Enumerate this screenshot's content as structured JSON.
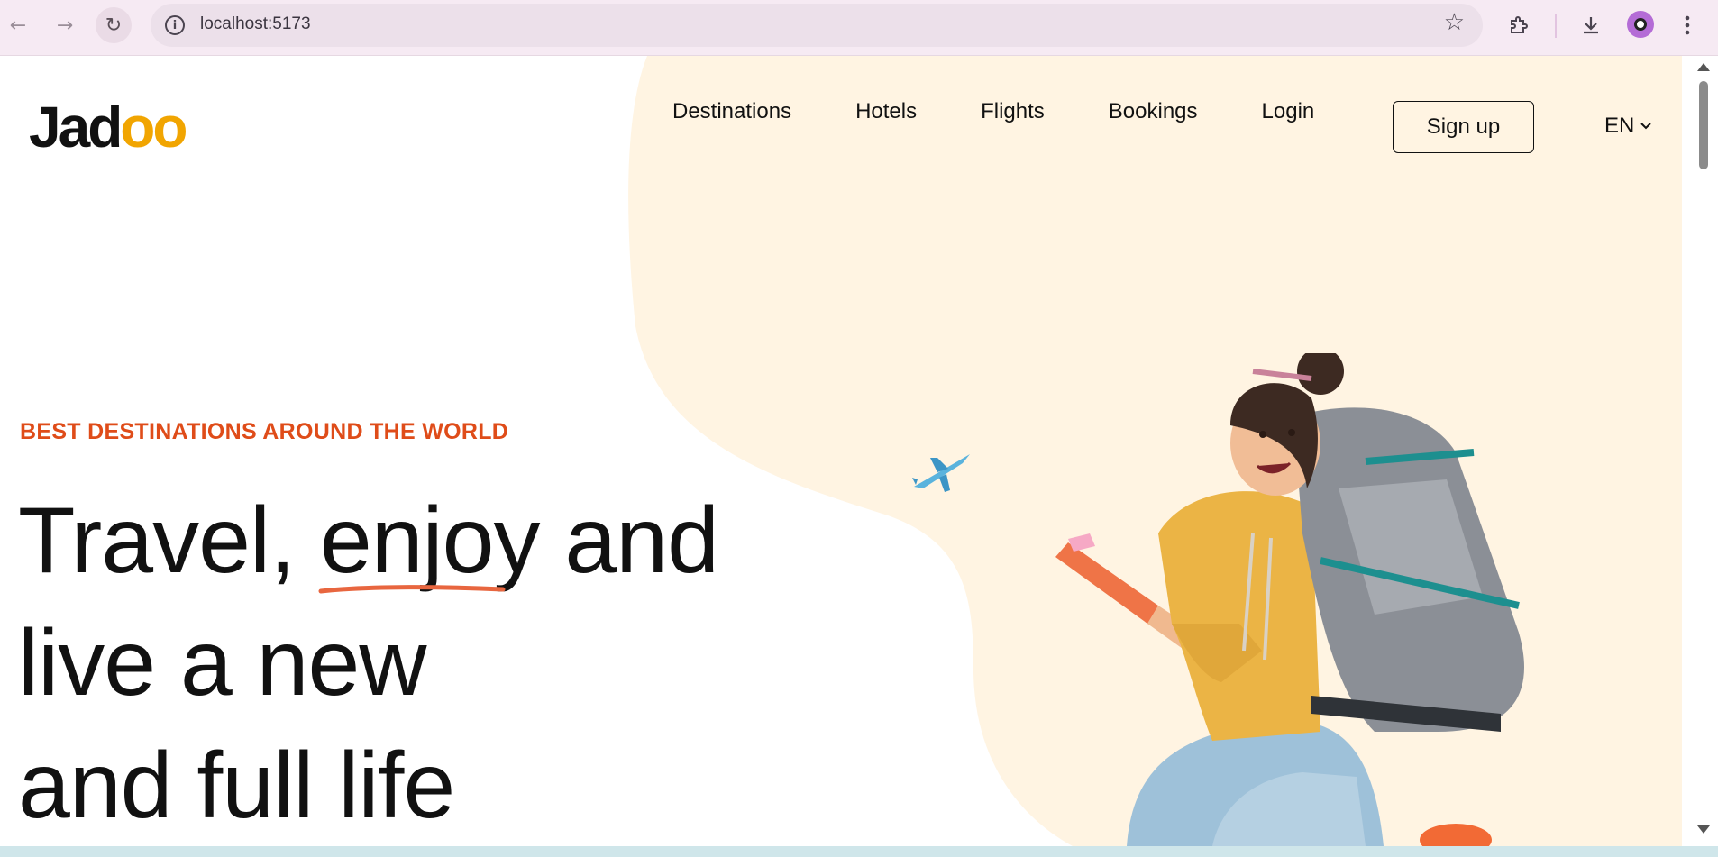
{
  "browser": {
    "url": "localhost:5173",
    "icons": {
      "back": "arrow-left-icon",
      "forward": "arrow-right-icon",
      "reload": "reload-icon",
      "site_info": "info-icon",
      "bookmark": "star-icon",
      "extensions": "puzzle-icon",
      "downloads": "download-icon",
      "profile": "avatar-icon",
      "menu": "kebab-menu-icon"
    }
  },
  "site": {
    "logo_prefix": "Jad",
    "logo_suffix": "oo",
    "accent_color": "#df4c19",
    "logo_accent_color": "#f1a501",
    "blob_color": "#fff4e2"
  },
  "nav": {
    "items": [
      {
        "label": "Destinations"
      },
      {
        "label": "Hotels"
      },
      {
        "label": "Flights"
      },
      {
        "label": "Bookings"
      },
      {
        "label": "Login"
      }
    ],
    "signup_label": "Sign up",
    "language": "EN"
  },
  "hero": {
    "subtitle": "BEST DESTINATIONS AROUND THE WORLD",
    "line1_before": "Travel, ",
    "line1_highlight": "enjoy",
    "line1_after": " and",
    "line2": "live a new",
    "line3": "and full life"
  }
}
